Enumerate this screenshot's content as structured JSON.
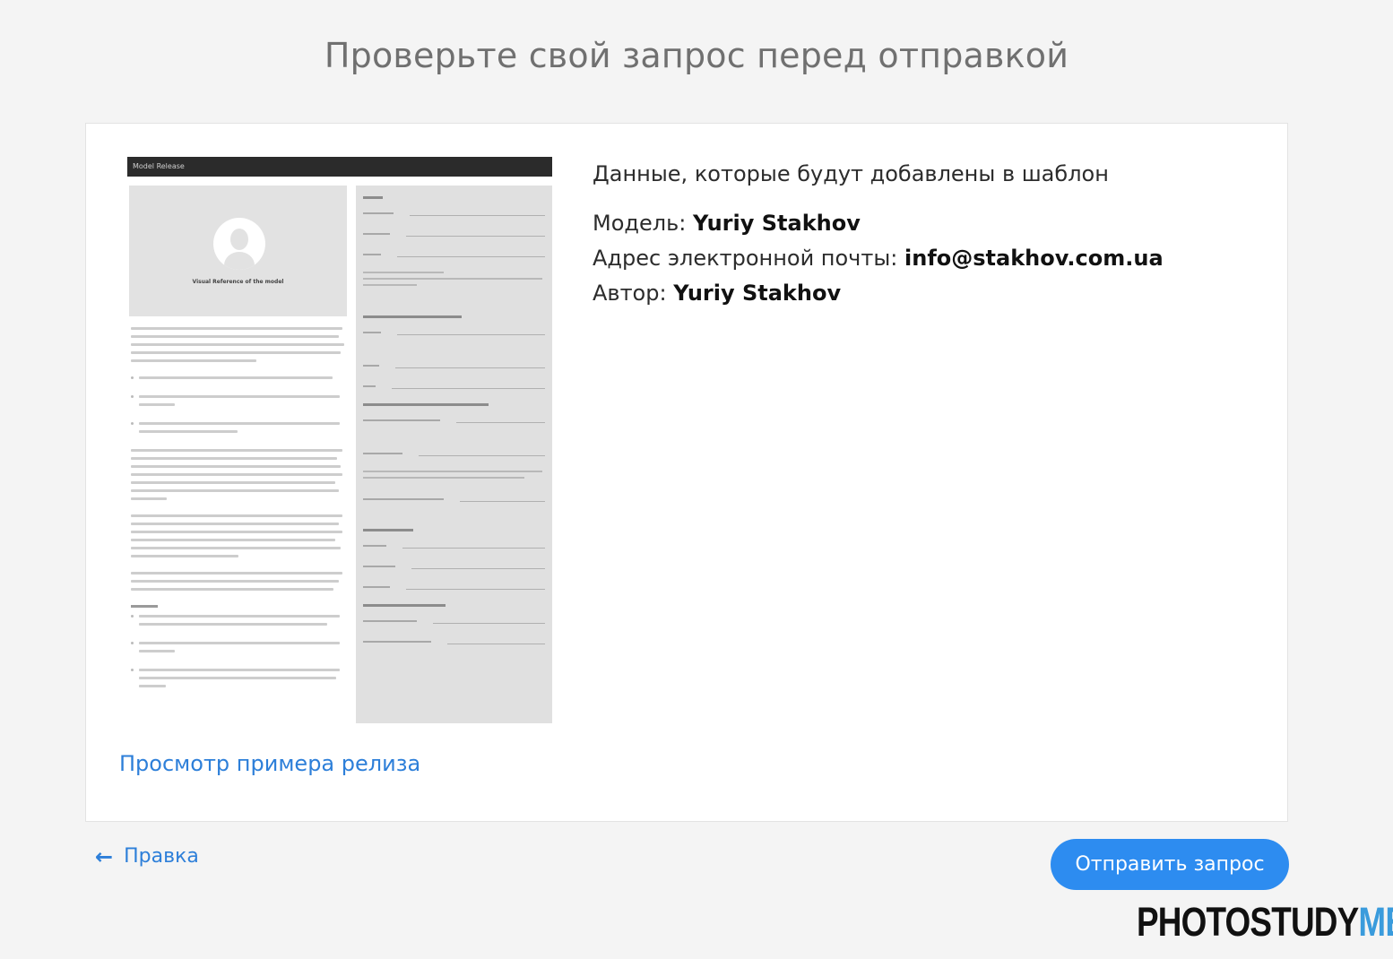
{
  "page": {
    "title": "Проверьте свой запрос перед отправкой"
  },
  "preview": {
    "header_label": "Model Release",
    "photo_caption": "Visual Reference of the model",
    "sample_link": "Просмотр примера релиза"
  },
  "info": {
    "heading": "Данные, которые будут добавлены в шаблон",
    "rows": [
      {
        "label": "Модель:",
        "value": "Yuriy Stakhov"
      },
      {
        "label": "Адрес электронной почты:",
        "value": "info@stakhov.com.ua"
      },
      {
        "label": "Автор:",
        "value": "Yuriy Stakhov"
      }
    ]
  },
  "footer": {
    "back_icon": "arrow-left-icon",
    "back_label": "Правка",
    "submit_label": "Отправить запрос"
  },
  "watermark": {
    "part1": "PHOTOSTUDY",
    "part2": "ME"
  },
  "colors": {
    "link": "#2d7fd9",
    "button": "#2d8cf0",
    "background": "#f4f4f4"
  }
}
